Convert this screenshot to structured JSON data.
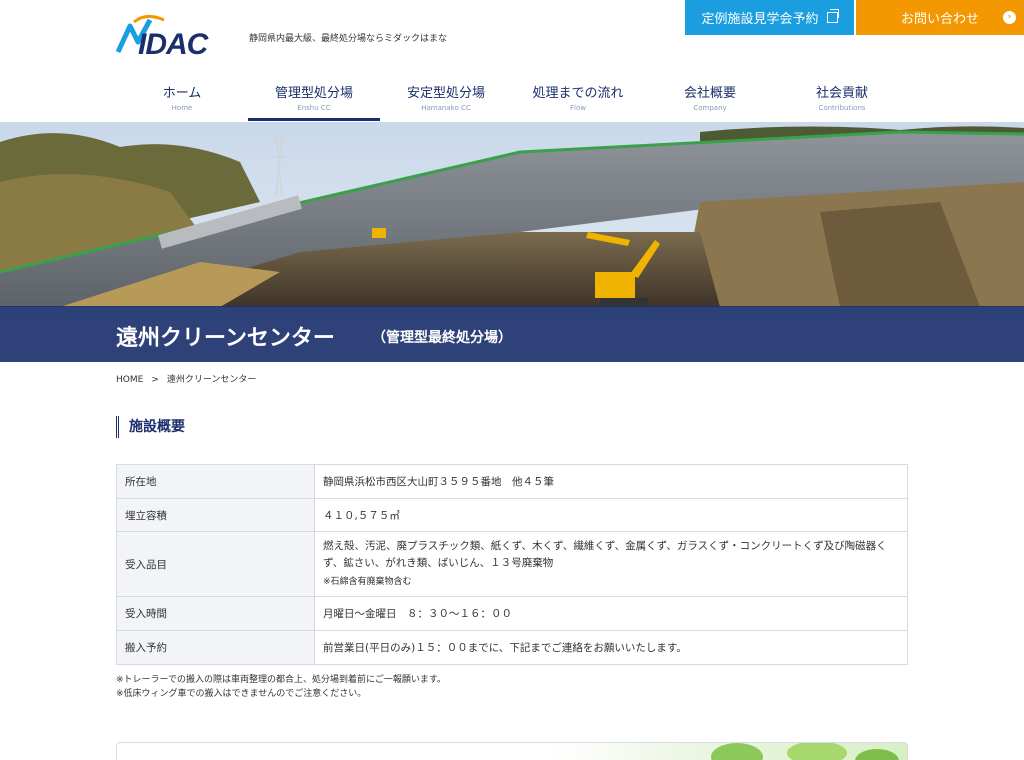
{
  "header": {
    "tagline": "静岡県内最大級、最終処分場ならミダックはまな",
    "tour_button": "定例施設見学会予約",
    "contact_button": "お問い合わせ"
  },
  "nav": [
    {
      "jp": "ホーム",
      "en": "Home"
    },
    {
      "jp": "管理型処分場",
      "en": "Enshu CC"
    },
    {
      "jp": "安定型処分場",
      "en": "Hamanako CC"
    },
    {
      "jp": "処理までの流れ",
      "en": "Flow"
    },
    {
      "jp": "会社概要",
      "en": "Company"
    },
    {
      "jp": "社会貢献",
      "en": "Contributions"
    }
  ],
  "hero": {
    "title": "遠州クリーンセンター",
    "subtitle": "（管理型最終処分場）"
  },
  "breadcrumb": {
    "home": "HOME",
    "separator": ">",
    "current": "遠州クリーンセンター"
  },
  "section": {
    "title": "施設概要"
  },
  "table": [
    {
      "label": "所在地",
      "value": "静岡県浜松市西区大山町３５９５番地　他４５筆"
    },
    {
      "label": "埋立容積",
      "value": "４１０,５７５㎥"
    },
    {
      "label": "受入品目",
      "value": "燃え殻、汚泥、廃プラスチック類、紙くず、木くず、繊維くず、金属くず、ガラスくず・コンクリートくず及び陶磁器くず、鉱さい、がれき類、ばいじん、１３号廃棄物",
      "note": "※石綿含有廃棄物含む"
    },
    {
      "label": "受入時間",
      "value": "月曜日～金曜日　８：３０～１６：００"
    },
    {
      "label": "搬入予約",
      "value": "前営業日(平日のみ)１５：００までに、下記までご連絡をお願いいたします。"
    }
  ],
  "notes": [
    "※トレーラーでの搬入の際は車両整理の都合上、処分場到着前にご一報願います。",
    "※低床ウィング車での搬入はできませんのでご注意ください。"
  ],
  "colors": {
    "navy": "#1a2f6b",
    "tour_blue": "#1a9ee0",
    "contact_orange": "#f39800"
  }
}
